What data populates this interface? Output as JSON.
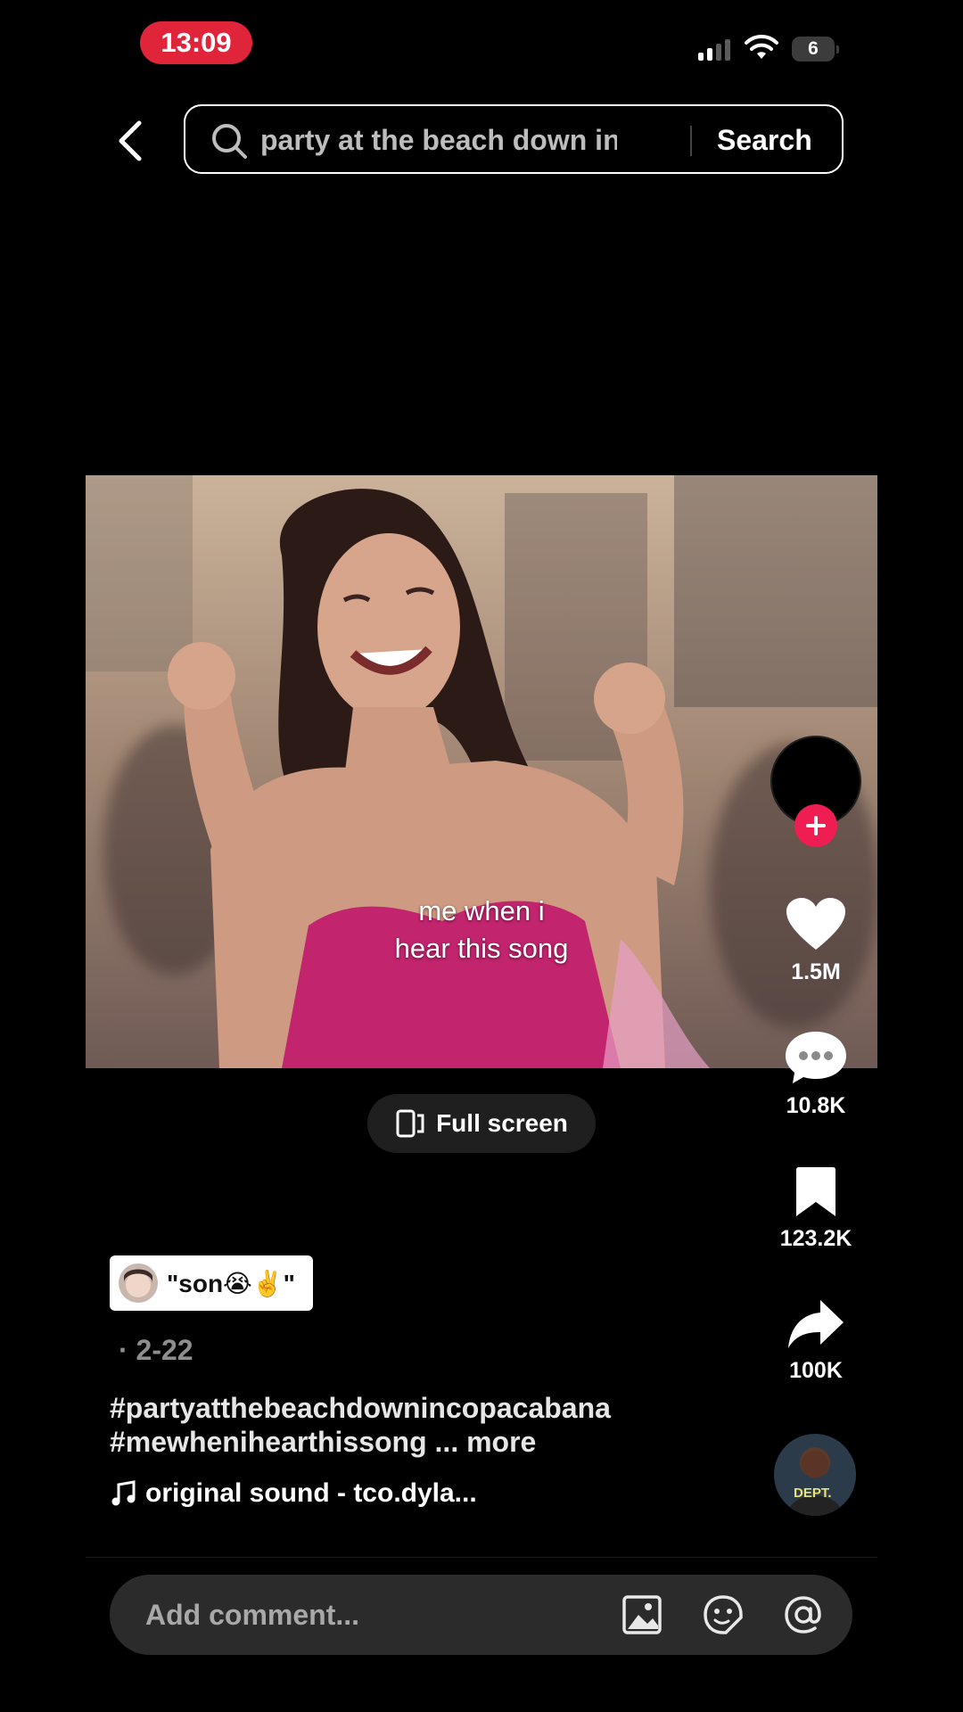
{
  "status_bar": {
    "time": "13:09",
    "battery": "6"
  },
  "header": {
    "search_query": "party at the beach down in...",
    "search_button": "Search"
  },
  "video": {
    "caption_line1": "me when i",
    "caption_line2": "hear this song"
  },
  "fullscreen_label": "Full screen",
  "actions": {
    "likes": "1.5M",
    "comments": "10.8K",
    "saves": "123.2K",
    "shares": "100K"
  },
  "post": {
    "sticker_text": "\"son😭✌️\"",
    "date": "· 2-22",
    "hashtags_line1": "#partyatthebeachdownincopacabana",
    "hashtags_line2": "#mewhenihearthissong",
    "more_label": "... more",
    "sound": "original sound - tco.dyla...",
    "sound_avatar_label": "DEPT."
  },
  "comment_bar": {
    "placeholder": "Add comment..."
  },
  "colors": {
    "accent": "#ee1d52",
    "time_pill": "#e0243a"
  }
}
